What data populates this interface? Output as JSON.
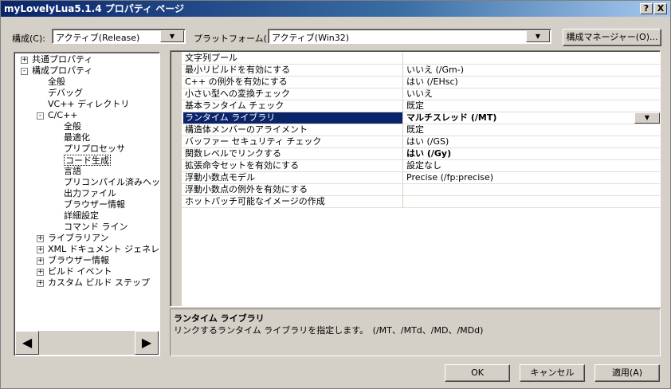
{
  "window": {
    "title": "myLovelyLua5.1.4 プロパティ ページ",
    "help_button": "?",
    "close_button": "X"
  },
  "toolbar": {
    "config_label": "構成(C):",
    "config_value": "アクティブ(Release)",
    "platform_label": "プラットフォーム(P):",
    "platform_value": "アクティブ(Win32)",
    "config_manager_button": "構成マネージャー(O)..."
  },
  "tree": {
    "nodes": [
      {
        "label": "共通プロパティ",
        "expander": "+"
      },
      {
        "label": "構成プロパティ",
        "expander": "-"
      },
      {
        "label": "全般"
      },
      {
        "label": "デバッグ"
      },
      {
        "label": "VC++ ディレクトリ"
      },
      {
        "label": "C/C++",
        "expander": "-"
      },
      {
        "label": "全般"
      },
      {
        "label": "最適化"
      },
      {
        "label": "プリプロセッサ"
      },
      {
        "label": "コード生成"
      },
      {
        "label": "言語"
      },
      {
        "label": "プリコンパイル済みヘッダー"
      },
      {
        "label": "出力ファイル"
      },
      {
        "label": "ブラウザー情報"
      },
      {
        "label": "詳細設定"
      },
      {
        "label": "コマンド ライン"
      },
      {
        "label": "ライブラリアン",
        "expander": "+"
      },
      {
        "label": "XML ドキュメント ジェネレーター",
        "expander": "+"
      },
      {
        "label": "ブラウザー情報",
        "expander": "+"
      },
      {
        "label": "ビルド イベント",
        "expander": "+"
      },
      {
        "label": "カスタム ビルド ステップ",
        "expander": "+"
      }
    ],
    "scroll_left": "◀",
    "scroll_right": "▶"
  },
  "grid": {
    "rows": [
      {
        "name": "文字列プール",
        "value": ""
      },
      {
        "name": "最小リビルドを有効にする",
        "value": "いいえ (/Gm-)"
      },
      {
        "name": "C++ の例外を有効にする",
        "value": "はい (/EHsc)"
      },
      {
        "name": "小さい型への変換チェック",
        "value": "いいえ"
      },
      {
        "name": "基本ランタイム チェック",
        "value": "既定"
      },
      {
        "name": "ランタイム ライブラリ",
        "value": "マルチスレッド (/MT)"
      },
      {
        "name": "構造体メンバーのアライメント",
        "value": "既定"
      },
      {
        "name": "バッファー セキュリティ チェック",
        "value": "はい (/GS)"
      },
      {
        "name": "関数レベルでリンクする",
        "value": "はい (/Gy)"
      },
      {
        "name": "拡張命令セットを有効にする",
        "value": "設定なし"
      },
      {
        "name": "浮動小数点モデル",
        "value": "Precise (/fp:precise)"
      },
      {
        "name": "浮動小数点の例外を有効にする",
        "value": ""
      },
      {
        "name": "ホットパッチ可能なイメージの作成",
        "value": ""
      }
    ]
  },
  "description": {
    "title": "ランタイム ライブラリ",
    "text": "リンクするランタイム ライブラリを指定します。　(/MT、/MTd、/MD、/MDd)"
  },
  "buttons": {
    "ok": "OK",
    "cancel": "キャンセル",
    "apply": "適用(A)"
  }
}
